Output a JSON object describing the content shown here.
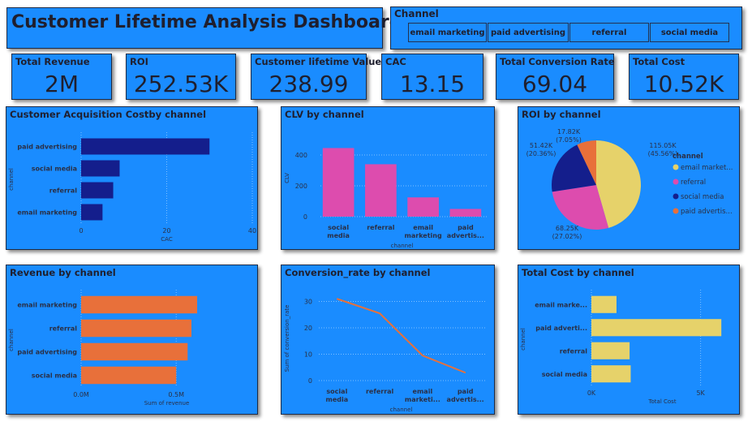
{
  "dashboard": {
    "title": "Customer Lifetime Analysis Dashboard"
  },
  "slicer": {
    "title": "Channel",
    "options": [
      "email marketing",
      "paid advertising",
      "referral",
      "social media"
    ]
  },
  "kpis": [
    {
      "label": "Total Revenue",
      "value": "2M"
    },
    {
      "label": "ROI",
      "value": "252.53K"
    },
    {
      "label": "Customer lifetime Value",
      "value": "238.99"
    },
    {
      "label": "CAC",
      "value": "13.15"
    },
    {
      "label": "Total Conversion Rate",
      "value": "69.04"
    },
    {
      "label": "Total Cost",
      "value": "10.52K"
    }
  ],
  "colors": {
    "background": "#1a8cff",
    "navy": "#141e8c",
    "pink": "#dd4cae",
    "orange": "#e8703a",
    "yellow": "#e6d26a"
  },
  "chart_data": [
    {
      "id": "cac",
      "type": "bar",
      "orientation": "horizontal",
      "title": "Customer Acquisition Costby channel",
      "xlabel": "CAC",
      "ylabel": "channel",
      "categories": [
        "paid advertising",
        "social media",
        "referral",
        "email marketing"
      ],
      "values": [
        30,
        9,
        7.5,
        5
      ],
      "xlim": [
        0,
        40
      ],
      "xticks": [
        "0",
        "20",
        "40"
      ],
      "color": "#141e8c"
    },
    {
      "id": "clv",
      "type": "bar",
      "orientation": "vertical",
      "title": "CLV by channel",
      "xlabel": "channel",
      "ylabel": "CLV",
      "categories": [
        "social media",
        "referral",
        "email marketing",
        "paid advertis..."
      ],
      "values": [
        445,
        340,
        125,
        50
      ],
      "ylim": [
        0,
        500
      ],
      "yticks": [
        "0",
        "200",
        "400"
      ],
      "color": "#dd4cae"
    },
    {
      "id": "roi",
      "type": "pie",
      "title": "ROI by channel",
      "legend_title": "channel",
      "legend": [
        "email market...",
        "referral",
        "social media",
        "paid advertis..."
      ],
      "values": [
        115.05,
        68.25,
        51.42,
        17.82
      ],
      "value_labels": [
        "115.05K",
        "68.25K",
        "51.42K",
        "17.82K"
      ],
      "pct_labels": [
        "(45.56%)",
        "(27.02%)",
        "(20.36%)",
        "(7.05%)"
      ],
      "colors": [
        "#e6d26a",
        "#dd4cae",
        "#141e8c",
        "#e8703a"
      ]
    },
    {
      "id": "revenue",
      "type": "bar",
      "orientation": "horizontal",
      "title": "Revenue by channel",
      "xlabel": "Sum of revenue",
      "ylabel": "channel",
      "categories": [
        "email marketing",
        "referral",
        "paid advertising",
        "social media"
      ],
      "values": [
        0.61,
        0.58,
        0.56,
        0.5
      ],
      "xlim": [
        0,
        0.9
      ],
      "xticks": [
        "0.0M",
        "0.5M"
      ],
      "color": "#e8703a"
    },
    {
      "id": "conversion",
      "type": "line",
      "title": "Conversion_rate by channel",
      "xlabel": "channel",
      "ylabel": "Sum of conversion_rate",
      "categories": [
        "social media",
        "referral",
        "email marketi...",
        "paid advertis..."
      ],
      "values": [
        31,
        25.5,
        9.5,
        3
      ],
      "ylim": [
        0,
        32
      ],
      "yticks": [
        "0",
        "10",
        "20",
        "30"
      ],
      "color": "#e8703a"
    },
    {
      "id": "cost",
      "type": "bar",
      "orientation": "horizontal",
      "title": "Total Cost by channel",
      "xlabel": "Total Cost",
      "ylabel": "channel",
      "categories": [
        "email marke...",
        "paid adverti...",
        "referral",
        "social media"
      ],
      "values": [
        1150,
        5950,
        1750,
        1800
      ],
      "xlim": [
        0,
        6500
      ],
      "xticks": [
        "0K",
        "5K"
      ],
      "color": "#e6d26a"
    }
  ]
}
